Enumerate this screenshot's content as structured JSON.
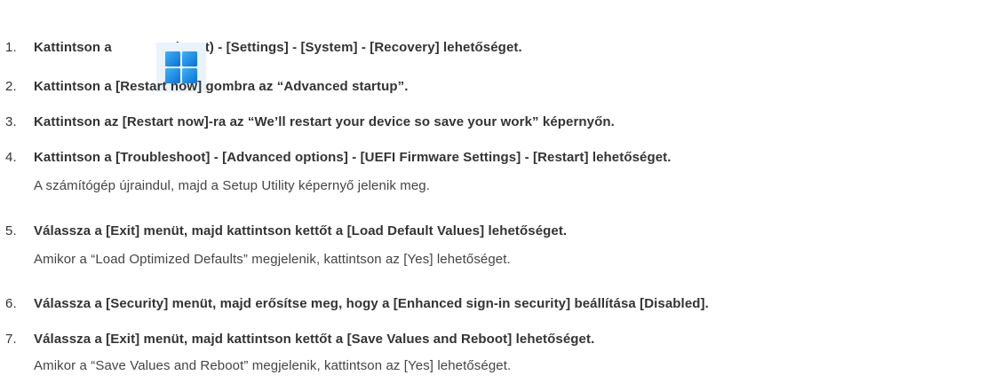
{
  "steps": [
    {
      "number": "1.",
      "before_icon": "Kattintson a",
      "icon": "windows-start-icon",
      "after_icon": "(Start) - [Settings] - [System] - [Recovery] lehetőséget."
    },
    {
      "number": "2.",
      "main": "Kattintson a [Restart now] gombra az “Advanced startup”."
    },
    {
      "number": "3.",
      "main": "Kattintson az [Restart now]-ra az “We’ll restart your device so save your work” képernyőn."
    },
    {
      "number": "4.",
      "main": "Kattintson a [Troubleshoot] - [Advanced options] - [UEFI Firmware Settings] - [Restart] lehetőséget.",
      "note": "A számítógép újraindul, majd a Setup Utility képernyő jelenik meg."
    },
    {
      "number": "5.",
      "main": "Válassza a [Exit] menüt, majd kattintson kettőt a [Load Default Values] lehetőséget.",
      "note": "Amikor a “Load Optimized Defaults” megjelenik, kattintson az [Yes] lehetőséget."
    },
    {
      "number": "6.",
      "main": "Válassza a [Security] menüt, majd erősítse meg, hogy a [Enhanced sign-in security] beállítása [Disabled]."
    },
    {
      "number": "7.",
      "main": "Válassza a [Exit] menüt, majd kattintson kettőt a [Save Values and Reboot] lehetőséget.",
      "note": "Amikor a “Save Values and Reboot” megjelenik, kattintson az [Yes] lehetőséget."
    }
  ],
  "colors": {
    "text": "#333333",
    "icon_gradient_top": "#3fb3f5",
    "icon_gradient_bottom": "#0a6fd6",
    "icon_background": "#eaf2fb"
  }
}
